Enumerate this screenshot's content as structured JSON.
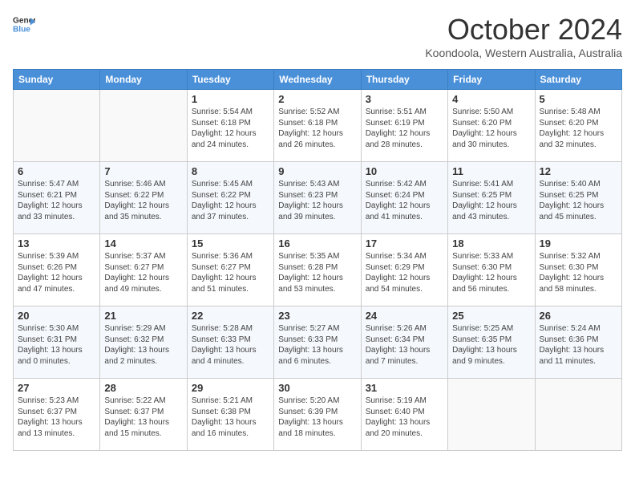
{
  "header": {
    "logo_line1": "General",
    "logo_line2": "Blue",
    "month_title": "October 2024",
    "subtitle": "Koondoola, Western Australia, Australia"
  },
  "weekdays": [
    "Sunday",
    "Monday",
    "Tuesday",
    "Wednesday",
    "Thursday",
    "Friday",
    "Saturday"
  ],
  "weeks": [
    [
      {
        "day": "",
        "info": ""
      },
      {
        "day": "",
        "info": ""
      },
      {
        "day": "1",
        "info": "Sunrise: 5:54 AM\nSunset: 6:18 PM\nDaylight: 12 hours and 24 minutes."
      },
      {
        "day": "2",
        "info": "Sunrise: 5:52 AM\nSunset: 6:18 PM\nDaylight: 12 hours and 26 minutes."
      },
      {
        "day": "3",
        "info": "Sunrise: 5:51 AM\nSunset: 6:19 PM\nDaylight: 12 hours and 28 minutes."
      },
      {
        "day": "4",
        "info": "Sunrise: 5:50 AM\nSunset: 6:20 PM\nDaylight: 12 hours and 30 minutes."
      },
      {
        "day": "5",
        "info": "Sunrise: 5:48 AM\nSunset: 6:20 PM\nDaylight: 12 hours and 32 minutes."
      }
    ],
    [
      {
        "day": "6",
        "info": "Sunrise: 5:47 AM\nSunset: 6:21 PM\nDaylight: 12 hours and 33 minutes."
      },
      {
        "day": "7",
        "info": "Sunrise: 5:46 AM\nSunset: 6:22 PM\nDaylight: 12 hours and 35 minutes."
      },
      {
        "day": "8",
        "info": "Sunrise: 5:45 AM\nSunset: 6:22 PM\nDaylight: 12 hours and 37 minutes."
      },
      {
        "day": "9",
        "info": "Sunrise: 5:43 AM\nSunset: 6:23 PM\nDaylight: 12 hours and 39 minutes."
      },
      {
        "day": "10",
        "info": "Sunrise: 5:42 AM\nSunset: 6:24 PM\nDaylight: 12 hours and 41 minutes."
      },
      {
        "day": "11",
        "info": "Sunrise: 5:41 AM\nSunset: 6:25 PM\nDaylight: 12 hours and 43 minutes."
      },
      {
        "day": "12",
        "info": "Sunrise: 5:40 AM\nSunset: 6:25 PM\nDaylight: 12 hours and 45 minutes."
      }
    ],
    [
      {
        "day": "13",
        "info": "Sunrise: 5:39 AM\nSunset: 6:26 PM\nDaylight: 12 hours and 47 minutes."
      },
      {
        "day": "14",
        "info": "Sunrise: 5:37 AM\nSunset: 6:27 PM\nDaylight: 12 hours and 49 minutes."
      },
      {
        "day": "15",
        "info": "Sunrise: 5:36 AM\nSunset: 6:27 PM\nDaylight: 12 hours and 51 minutes."
      },
      {
        "day": "16",
        "info": "Sunrise: 5:35 AM\nSunset: 6:28 PM\nDaylight: 12 hours and 53 minutes."
      },
      {
        "day": "17",
        "info": "Sunrise: 5:34 AM\nSunset: 6:29 PM\nDaylight: 12 hours and 54 minutes."
      },
      {
        "day": "18",
        "info": "Sunrise: 5:33 AM\nSunset: 6:30 PM\nDaylight: 12 hours and 56 minutes."
      },
      {
        "day": "19",
        "info": "Sunrise: 5:32 AM\nSunset: 6:30 PM\nDaylight: 12 hours and 58 minutes."
      }
    ],
    [
      {
        "day": "20",
        "info": "Sunrise: 5:30 AM\nSunset: 6:31 PM\nDaylight: 13 hours and 0 minutes."
      },
      {
        "day": "21",
        "info": "Sunrise: 5:29 AM\nSunset: 6:32 PM\nDaylight: 13 hours and 2 minutes."
      },
      {
        "day": "22",
        "info": "Sunrise: 5:28 AM\nSunset: 6:33 PM\nDaylight: 13 hours and 4 minutes."
      },
      {
        "day": "23",
        "info": "Sunrise: 5:27 AM\nSunset: 6:33 PM\nDaylight: 13 hours and 6 minutes."
      },
      {
        "day": "24",
        "info": "Sunrise: 5:26 AM\nSunset: 6:34 PM\nDaylight: 13 hours and 7 minutes."
      },
      {
        "day": "25",
        "info": "Sunrise: 5:25 AM\nSunset: 6:35 PM\nDaylight: 13 hours and 9 minutes."
      },
      {
        "day": "26",
        "info": "Sunrise: 5:24 AM\nSunset: 6:36 PM\nDaylight: 13 hours and 11 minutes."
      }
    ],
    [
      {
        "day": "27",
        "info": "Sunrise: 5:23 AM\nSunset: 6:37 PM\nDaylight: 13 hours and 13 minutes."
      },
      {
        "day": "28",
        "info": "Sunrise: 5:22 AM\nSunset: 6:37 PM\nDaylight: 13 hours and 15 minutes."
      },
      {
        "day": "29",
        "info": "Sunrise: 5:21 AM\nSunset: 6:38 PM\nDaylight: 13 hours and 16 minutes."
      },
      {
        "day": "30",
        "info": "Sunrise: 5:20 AM\nSunset: 6:39 PM\nDaylight: 13 hours and 18 minutes."
      },
      {
        "day": "31",
        "info": "Sunrise: 5:19 AM\nSunset: 6:40 PM\nDaylight: 13 hours and 20 minutes."
      },
      {
        "day": "",
        "info": ""
      },
      {
        "day": "",
        "info": ""
      }
    ]
  ]
}
